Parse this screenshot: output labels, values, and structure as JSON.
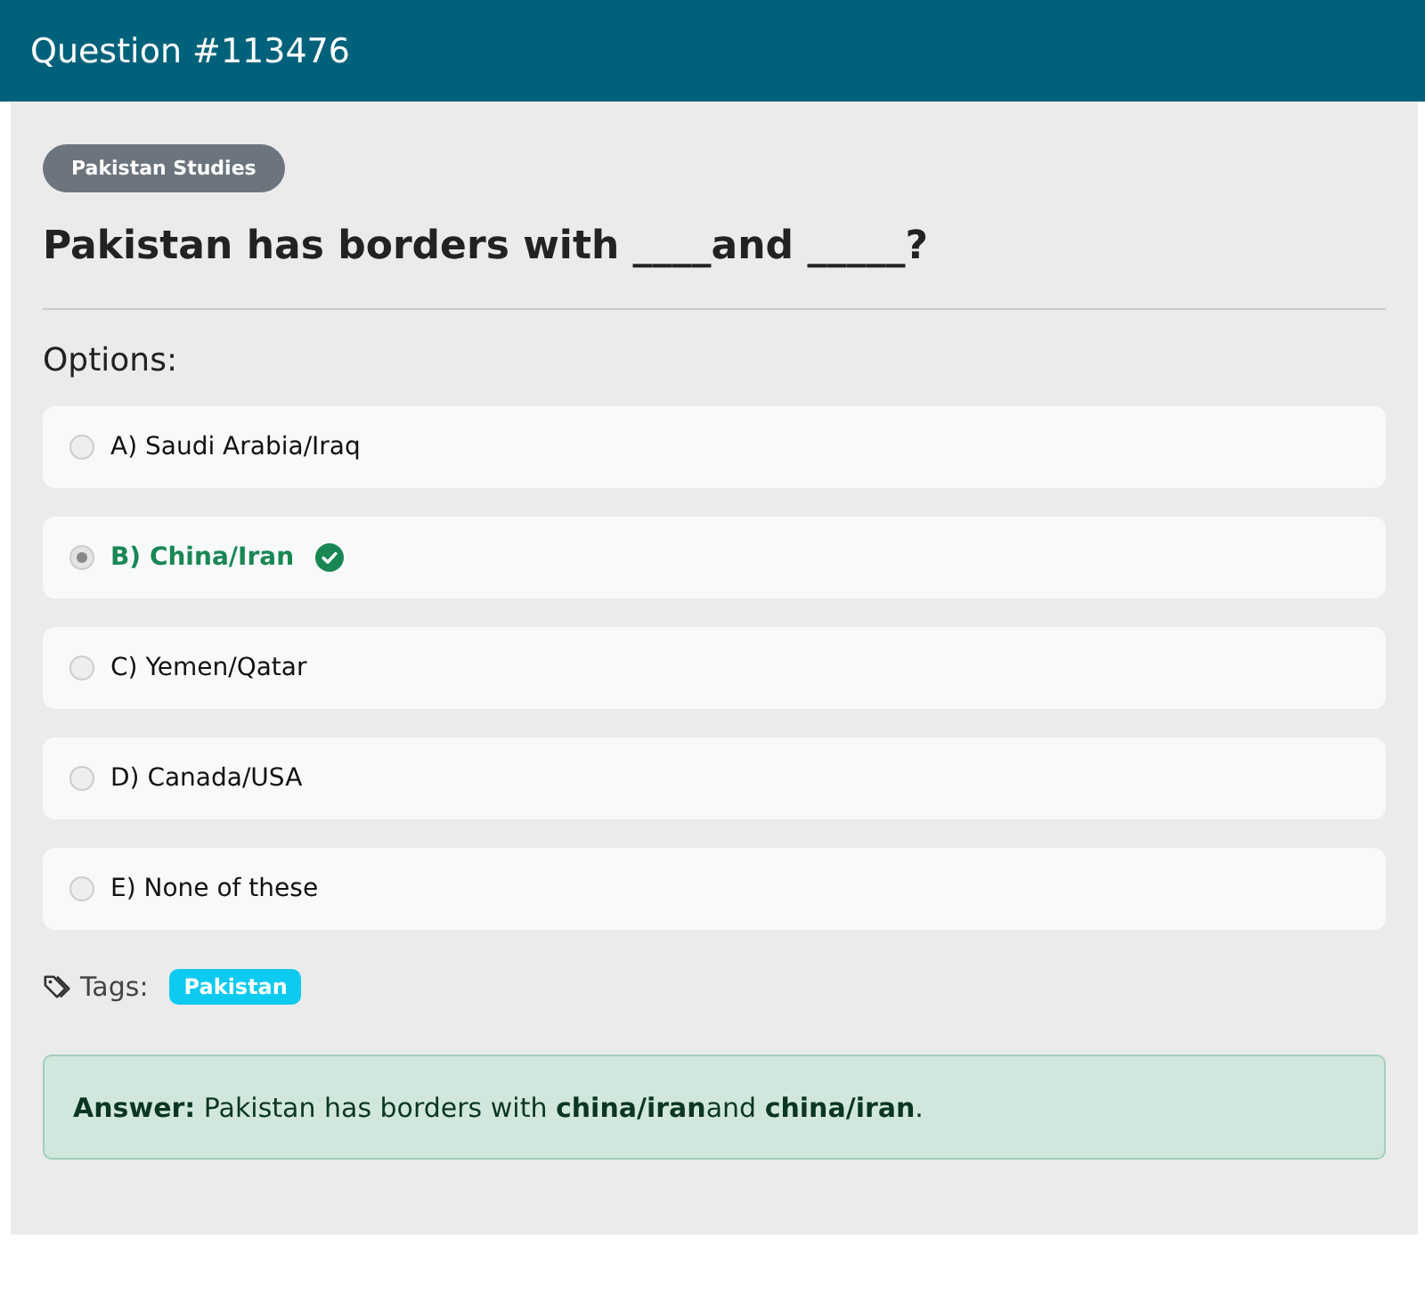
{
  "header": {
    "title": "Question #113476"
  },
  "category": "Pakistan Studies",
  "question": "Pakistan has borders with ____and _____?",
  "options_label": "Options:",
  "options": [
    {
      "label": "A) Saudi Arabia/Iraq",
      "selected": false,
      "correct": false
    },
    {
      "label": "B) China/Iran",
      "selected": true,
      "correct": true
    },
    {
      "label": "C) Yemen/Qatar",
      "selected": false,
      "correct": false
    },
    {
      "label": "D) Canada/USA",
      "selected": false,
      "correct": false
    },
    {
      "label": "E) None of these",
      "selected": false,
      "correct": false
    }
  ],
  "tags_label": "Tags:",
  "tags": [
    "Pakistan"
  ],
  "answer": "**Answer:** Pakistan has borders with **china/iran**and **china/iran**."
}
